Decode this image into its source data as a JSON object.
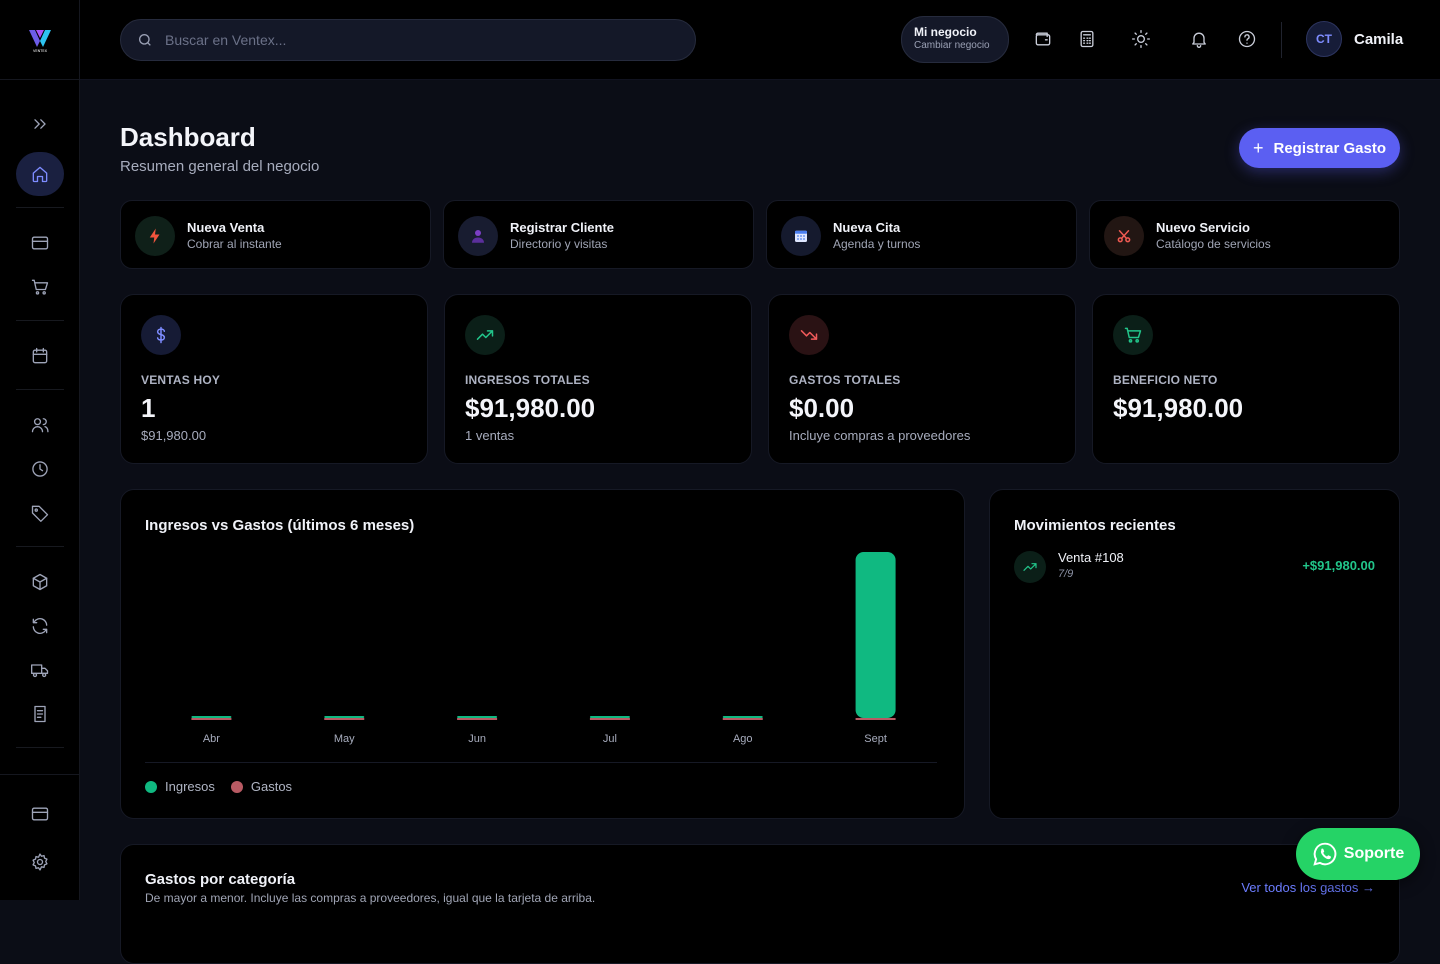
{
  "brand": {
    "name": "VENTEX"
  },
  "search": {
    "placeholder": "Buscar en Ventex..."
  },
  "business": {
    "name": "Mi negocio",
    "action": "Cambiar negocio"
  },
  "user": {
    "initials": "CT",
    "name": "Camila"
  },
  "header": {
    "title": "Dashboard",
    "subtitle": "Resumen general del negocio",
    "primary_button": "Registrar Gasto"
  },
  "quick_actions": [
    {
      "title": "Nueva Venta",
      "subtitle": "Cobrar al instante",
      "icon": "bolt-icon"
    },
    {
      "title": "Registrar Cliente",
      "subtitle": "Directorio y visitas",
      "icon": "user-icon"
    },
    {
      "title": "Nueva Cita",
      "subtitle": "Agenda y turnos",
      "icon": "calendar-icon"
    },
    {
      "title": "Nuevo Servicio",
      "subtitle": "Catálogo de servicios",
      "icon": "scissors-icon"
    }
  ],
  "stats": [
    {
      "label": "VENTAS HOY",
      "value": "1",
      "sub": "$91,980.00",
      "icon": "dollar-icon",
      "color": "#7e8cff"
    },
    {
      "label": "INGRESOS TOTALES",
      "value": "$91,980.00",
      "sub": "1 ventas",
      "icon": "trending-up-icon",
      "color": "#22c58a"
    },
    {
      "label": "GASTOS TOTALES",
      "value": "$0.00",
      "sub": "Incluye compras a proveedores",
      "icon": "trending-down-icon",
      "color": "#ef5a5a"
    },
    {
      "label": "BENEFICIO NETO",
      "value": "$91,980.00",
      "sub": "",
      "icon": "cart-icon",
      "color": "#22c58a"
    }
  ],
  "chart": {
    "title": "Ingresos vs Gastos (últimos 6 meses)",
    "legend": [
      "Ingresos",
      "Gastos"
    ]
  },
  "chart_data": {
    "type": "bar",
    "title": "Ingresos vs Gastos (últimos 6 meses)",
    "categories": [
      "Abr",
      "May",
      "Jun",
      "Jul",
      "Ago",
      "Sept"
    ],
    "series": [
      {
        "name": "Ingresos",
        "values": [
          0,
          0,
          0,
          0,
          0,
          91980
        ],
        "color": "#10b981"
      },
      {
        "name": "Gastos",
        "values": [
          0,
          0,
          0,
          0,
          0,
          0
        ],
        "color": "#b85a63"
      }
    ],
    "ylim": [
      0,
      91980
    ],
    "grid": false,
    "legend_position": "bottom-left"
  },
  "movements": {
    "title": "Movimientos recientes",
    "items": [
      {
        "title": "Venta #108",
        "date": "7/9",
        "amount": "+$91,980.00"
      }
    ]
  },
  "categories_panel": {
    "title": "Gastos por categoría",
    "subtitle": "De mayor a menor. Incluye las compras a proveedores, igual que la tarjeta de arriba.",
    "link": "Ver todos los gastos →"
  },
  "support": {
    "label": "Soporte"
  }
}
